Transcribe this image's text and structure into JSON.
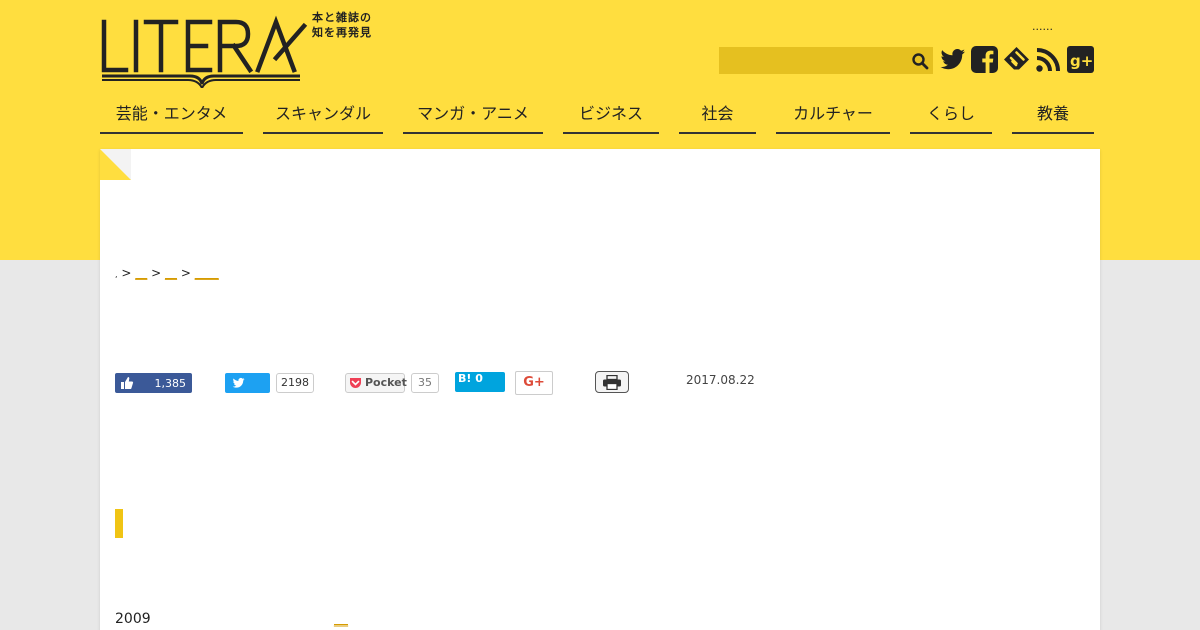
{
  "header": {
    "tagline_line1": "本と雑誌の",
    "tagline_line2": "知を再発見",
    "top_link": "......",
    "search": {
      "placeholder": "",
      "value": ""
    }
  },
  "social_icons": [
    "twitter-icon",
    "facebook-icon",
    "feedly-icon",
    "rss-icon",
    "google-plus-icon"
  ],
  "nav": {
    "items": [
      {
        "label": "芸能・エンタメ"
      },
      {
        "label": "スキャンダル"
      },
      {
        "label": "マンガ・アニメ"
      },
      {
        "label": "ビジネス"
      },
      {
        "label": "社会"
      },
      {
        "label": "カルチャー"
      },
      {
        "label": "くらし"
      },
      {
        "label": "教養"
      }
    ]
  },
  "breadcrumb": {
    "home": ",",
    "sep": ">",
    "items": [
      "__",
      "__",
      "____"
    ]
  },
  "share": {
    "facebook_count": "1,385",
    "twitter_count": "2198",
    "pocket_label": "Pocket",
    "pocket_count": "35",
    "hatena_label": "B!",
    "hatena_count": "0",
    "gplus_label": "G+"
  },
  "article": {
    "date": "2017.08.22",
    "year_text": "2009",
    "inline_link": "__"
  },
  "colors": {
    "brand_yellow": "#ffde3f",
    "link": "#d69b00",
    "accent_bar": "#f0c414"
  }
}
